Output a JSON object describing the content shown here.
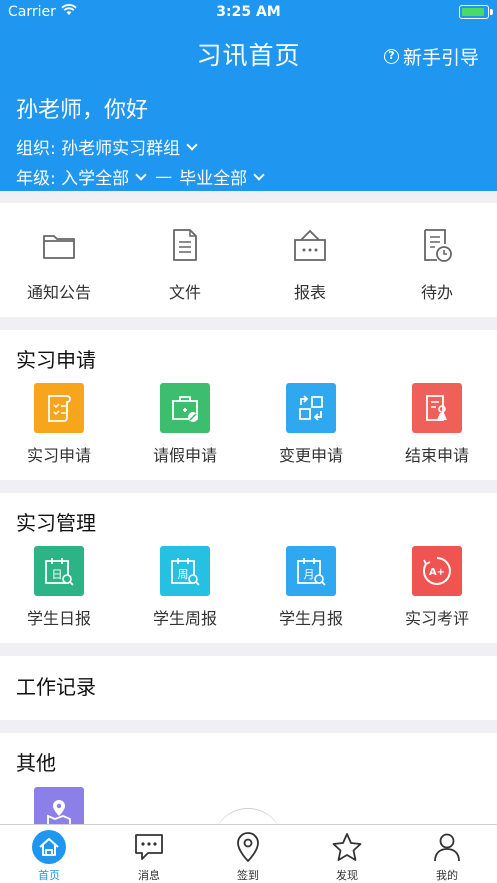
{
  "status_bar": {
    "carrier": "Carrier",
    "time": "3:25 AM"
  },
  "nav": {
    "title": "习讯首页",
    "guide_label": "新手引导"
  },
  "profile": {
    "greeting": "孙老师，你好",
    "org": "组织: 孙老师实习群组",
    "grade_from": "年级: 入学全部",
    "grade_dash": "—",
    "grade_to": "毕业全部"
  },
  "quick": [
    {
      "label": "通知公告",
      "icon": "folder-icon"
    },
    {
      "label": "文件",
      "icon": "document-icon"
    },
    {
      "label": "报表",
      "icon": "report-icon"
    },
    {
      "label": "待办",
      "icon": "todo-icon"
    }
  ],
  "apply": {
    "title": "实习申请",
    "items": [
      {
        "label": "实习申请",
        "icon": "internship-apply-icon",
        "color": "#f7a51c"
      },
      {
        "label": "请假申请",
        "icon": "leave-apply-icon",
        "color": "#3dbd6e"
      },
      {
        "label": "变更申请",
        "icon": "change-apply-icon",
        "color": "#2fa8f0"
      },
      {
        "label": "结束申请",
        "icon": "end-apply-icon",
        "color": "#f0605a"
      }
    ]
  },
  "manage": {
    "title": "实习管理",
    "items": [
      {
        "label": "学生日报",
        "icon": "daily-report-icon",
        "color": "#2db486",
        "glyph": "日"
      },
      {
        "label": "学生周报",
        "icon": "weekly-report-icon",
        "color": "#26c0e3",
        "glyph": "周"
      },
      {
        "label": "学生月报",
        "icon": "monthly-report-icon",
        "color": "#2fa8f0",
        "glyph": "月"
      },
      {
        "label": "实习考评",
        "icon": "evaluation-icon",
        "color": "#ef5450",
        "glyph": "A+"
      }
    ]
  },
  "work": {
    "title": "工作记录"
  },
  "other": {
    "title": "其他",
    "items": [
      {
        "icon": "location-map-icon",
        "color": "#8d7fe8"
      }
    ]
  },
  "tabbar": {
    "tabs": [
      {
        "label": "首页",
        "icon": "home-icon",
        "active": true
      },
      {
        "label": "消息",
        "icon": "message-icon",
        "active": false
      },
      {
        "label": "签到",
        "icon": "checkin-location-icon",
        "active": false
      },
      {
        "label": "发现",
        "icon": "star-icon",
        "active": false
      },
      {
        "label": "我的",
        "icon": "person-icon",
        "active": false
      }
    ],
    "active_color": "#1f96f0"
  }
}
